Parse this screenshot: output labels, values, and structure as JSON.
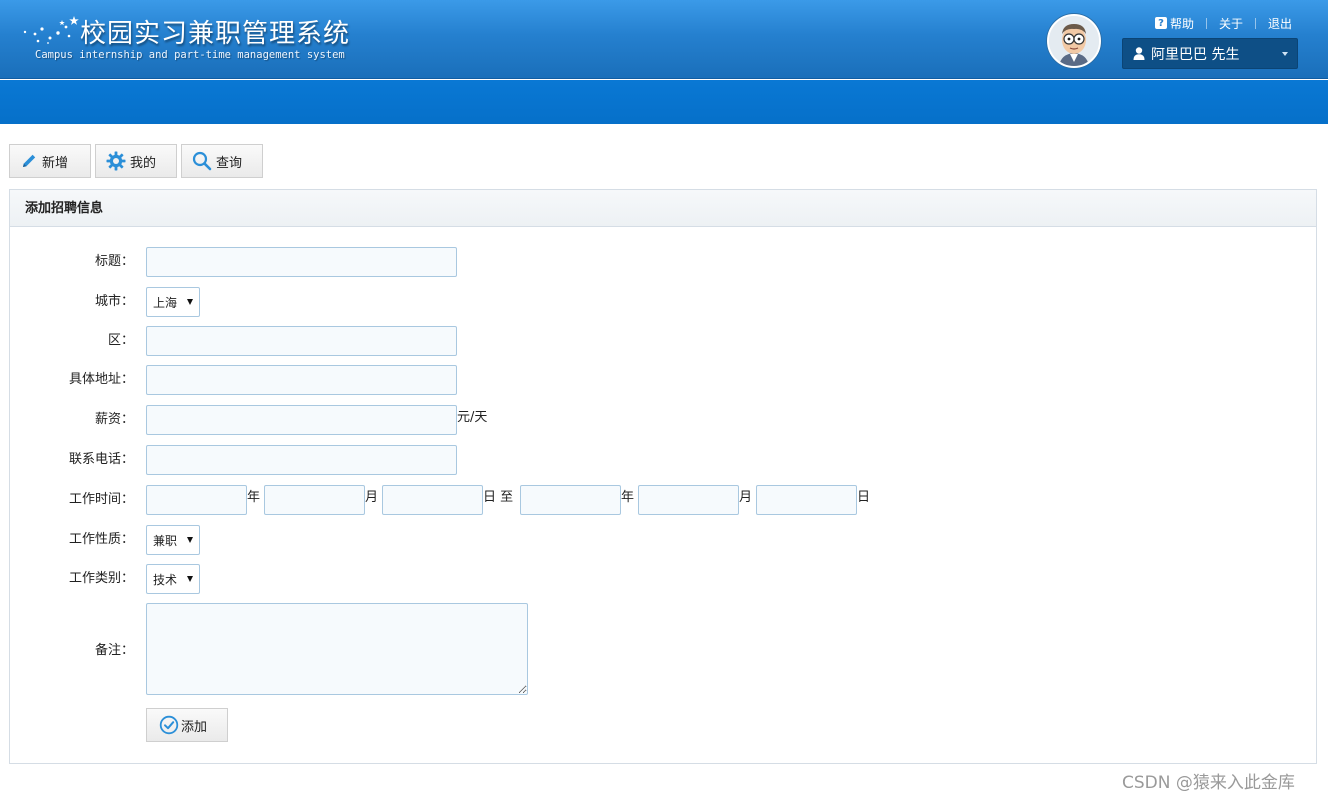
{
  "header": {
    "title": "校园实习兼职管理系统",
    "subtitle": "Campus internship and part-time management system",
    "links": {
      "help": "帮助",
      "about": "关于",
      "logout": "退出"
    },
    "user_name": "阿里巴巴 先生"
  },
  "colors": {
    "header_top": "#3b9ae8",
    "nav_bar": "#0670c9",
    "user_box": "#0e4f86",
    "icon_blue": "#2b8fd8",
    "input_border": "#a9c8e0"
  },
  "toolbar": {
    "new_label": "新增",
    "new_icon": "pencil-icon",
    "mine_label": "我的",
    "mine_icon": "gear-icon",
    "query_label": "查询",
    "query_icon": "search-icon"
  },
  "panel": {
    "title": "添加招聘信息"
  },
  "form": {
    "title_label": "标题：",
    "title_value": "",
    "city_label": "城市：",
    "city_value": "上海",
    "district_label": "区：",
    "district_value": "",
    "address_label": "具体地址：",
    "address_value": "",
    "salary_label": "薪资：",
    "salary_value": "",
    "salary_unit": "元/天",
    "phone_label": "联系电话：",
    "phone_value": "",
    "work_time_label": "工作时间：",
    "unit_year": "年",
    "unit_month": "月",
    "unit_day_to": "日 至",
    "unit_day": "日",
    "nature_label": "工作性质：",
    "nature_value": "兼职",
    "category_label": "工作类别：",
    "category_value": "技术",
    "remark_label": "备注：",
    "remark_value": "",
    "submit_label": "添加",
    "submit_icon": "check-circle-icon"
  },
  "watermark": "CSDN @猿来入此金库"
}
